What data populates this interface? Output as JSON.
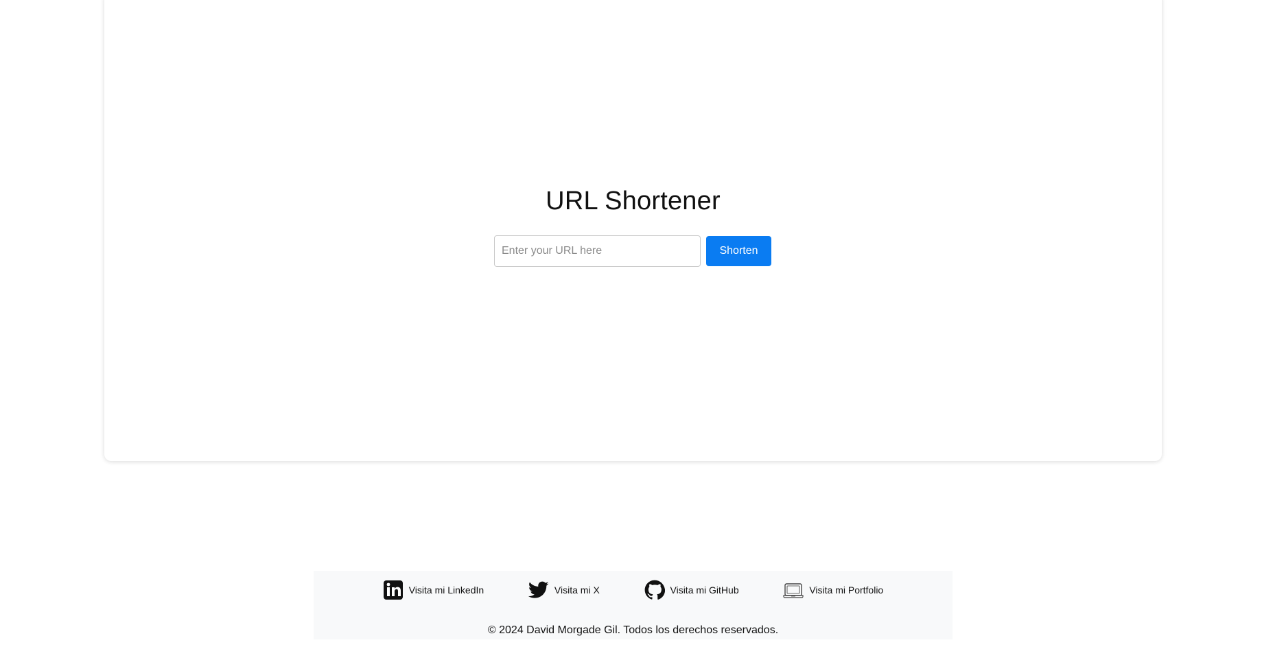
{
  "main": {
    "title": "URL Shortener",
    "url_input": {
      "placeholder": "Enter your URL here",
      "value": ""
    },
    "shorten_label": "Shorten"
  },
  "footer": {
    "links": [
      {
        "label": "Visita mi LinkedIn",
        "icon": "linkedin-icon"
      },
      {
        "label": "Visita mi X",
        "icon": "twitter-icon"
      },
      {
        "label": "Visita mi GitHub",
        "icon": "github-icon"
      },
      {
        "label": "Visita mi Portfolio",
        "icon": "portfolio-icon"
      }
    ],
    "copyright": "© 2024 David Morgade Gil. Todos los derechos reservados."
  },
  "colors": {
    "accent": "#0a7cf2",
    "footer_bg": "#f8f9fa"
  }
}
